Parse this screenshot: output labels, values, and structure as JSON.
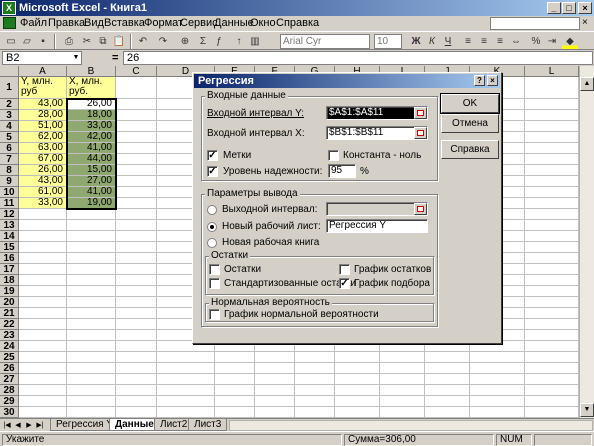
{
  "window": {
    "title": "Microsoft Excel - Книга1"
  },
  "menu": [
    "Файл",
    "Правка",
    "Вид",
    "Вставка",
    "Формат",
    "Сервис",
    "Данные",
    "Окно",
    "Справка"
  ],
  "toolbar": {
    "font": "Arial Cyr",
    "size": "10",
    "bold": "Ж",
    "italic": "К",
    "underline": "Ч",
    "sigma": "Σ"
  },
  "formula_bar": {
    "cell_ref": "B2",
    "eq": "=",
    "value": "26"
  },
  "columns": [
    "A",
    "B",
    "C",
    "D",
    "E",
    "F",
    "G",
    "H",
    "I",
    "J",
    "K",
    "L"
  ],
  "rows": [
    "1",
    "2",
    "3",
    "4",
    "5",
    "6",
    "7",
    "8",
    "9",
    "10",
    "11",
    "12",
    "13",
    "14",
    "15",
    "16",
    "17",
    "18",
    "19",
    "20",
    "21",
    "22",
    "23",
    "24",
    "25",
    "26",
    "27",
    "28",
    "29",
    "30"
  ],
  "header_a": [
    "Y, млн.",
    "руб"
  ],
  "header_b": [
    "X, млн.",
    "руб."
  ],
  "col_a": [
    "43,00",
    "28,00",
    "51,00",
    "62,00",
    "63,00",
    "67,00",
    "26,00",
    "43,00",
    "61,00",
    "33,00"
  ],
  "col_b": [
    "26,00",
    "18,00",
    "33,00",
    "42,00",
    "41,00",
    "44,00",
    "15,00",
    "27,00",
    "41,00",
    "19,00"
  ],
  "sheets": [
    "Регрессия Y",
    "Данные",
    "Лист2",
    "Лист3"
  ],
  "active_sheet_index": 1,
  "status": {
    "ready": "Укажите",
    "sum": "Сумма=306,00",
    "num": "NUM"
  },
  "dialog": {
    "title": "Регрессия",
    "input_group": "Входные данные",
    "y_label": "Входной интервал Y:",
    "y_value": "$A$1:$A$11",
    "x_label": "Входной интервал X:",
    "x_value": "$B$1:$B$11",
    "labels_cb": "Метки",
    "const_cb": "Константа - ноль",
    "conf_cb": "Уровень надежности:",
    "conf_value": "95",
    "pct": "%",
    "output_group": "Параметры вывода",
    "out_range": "Выходной интервал:",
    "new_sheet": "Новый рабочий лист:",
    "new_sheet_value": "Регрессия Y",
    "new_book": "Новая рабочая книга",
    "residuals_group": "Остатки",
    "residuals": "Остатки",
    "std_residuals": "Стандартизованные остатки",
    "resid_plot": "График остатков",
    "fit_plot": "График подбора",
    "normal_group": "Нормальная вероятность",
    "normal_plot": "График нормальной вероятности",
    "ok": "OK",
    "cancel": "Отмена",
    "help": "Справка",
    "check": "✓"
  }
}
